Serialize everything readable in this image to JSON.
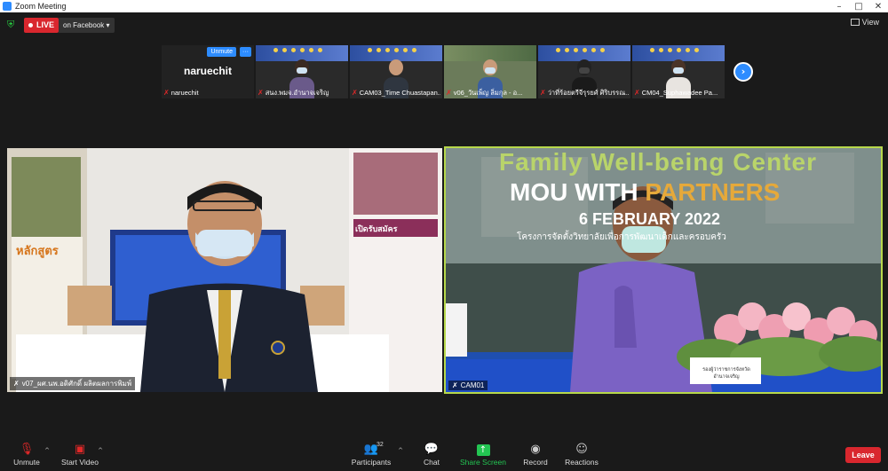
{
  "window": {
    "title": "Zoom Meeting",
    "controls": [
      "–",
      "□",
      "✕"
    ]
  },
  "topbar": {
    "live_label": "LIVE",
    "stream_target": "on Facebook ▾",
    "view_label": "View"
  },
  "strip": {
    "namecard": {
      "name": "naruechit",
      "unmute_label": "Unmute",
      "more_label": "···",
      "label": "naruechit"
    },
    "tiles": [
      {
        "label": "สนง.พมจ.อำนาจเจริญ"
      },
      {
        "label": "CAM03_Time Chuastapan..."
      },
      {
        "label": "v06_วันเพ็ญ ลิ่มกุล - อ..."
      },
      {
        "label": "ว่าที่ร้อยตรีจีรุรยศ์ ศิริบรรณ..."
      },
      {
        "label": "CM04_Suphawadee Pa..."
      }
    ]
  },
  "main_videos": [
    {
      "label": "v07_ผศ.นพ.อดิศักดิ์ ผลิตผลการพิมพ์"
    },
    {
      "label": "CAM01"
    }
  ],
  "slide_text": {
    "line1": "Family Well-being Center",
    "line2a": "MOU WITH ",
    "line2b": "PARTNERS",
    "line3": "6 FEBRUARY 2022",
    "line4": "โครงการจัดตั้งวิทยาลัยเพื่อการพัฒนาเด็กและครอบครัว",
    "nameplate": "รองผู้ว่าราชการจังหวัดอำนาจเจริญ"
  },
  "left_poster": {
    "title": "หลักสูตร",
    "recruit": "เปิดรับสมัคร"
  },
  "toolbar": {
    "unmute": "Unmute",
    "start_video": "Start Video",
    "participants": "Participants",
    "participants_count": "32",
    "chat": "Chat",
    "share_screen": "Share Screen",
    "record": "Record",
    "reactions": "Reactions",
    "leave": "Leave"
  }
}
